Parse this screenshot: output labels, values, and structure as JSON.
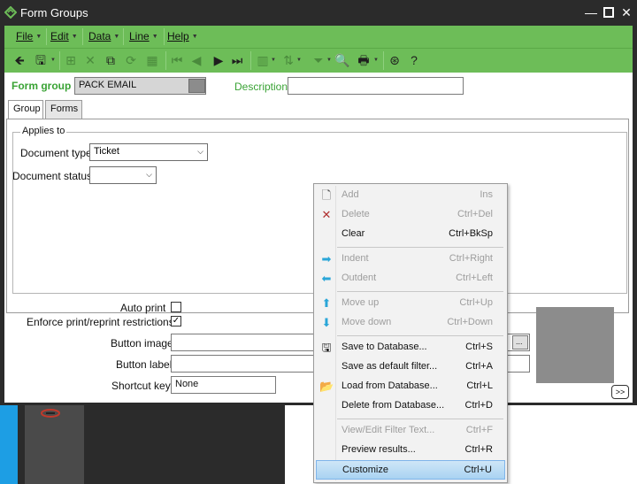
{
  "window": {
    "title": "Form Groups",
    "controls": {
      "minimize": "—",
      "close": "✕"
    }
  },
  "menubar": [
    "File",
    "Edit",
    "Data",
    "Line",
    "Help"
  ],
  "toolbar": {
    "icons": [
      "back-icon",
      "save-icon",
      "add-icon",
      "delete-icon",
      "copy-icon",
      "refresh-icon",
      "grid-icon",
      "first-record-icon",
      "prev-record-icon",
      "next-record-icon",
      "last-record-icon",
      "column-icon",
      "sort-icon",
      "filter-icon",
      "search-icon",
      "print-icon",
      "help-icon",
      "question-icon"
    ]
  },
  "header": {
    "form_group_label": "Form group",
    "form_group_value": "PACK EMAIL",
    "description_label": "Description",
    "description_value": ""
  },
  "tabs": [
    {
      "label": "Group",
      "active": true
    },
    {
      "label": "Forms",
      "active": false
    }
  ],
  "applies_to": {
    "title": "Applies to",
    "document_type_label": "Document type",
    "document_type_value": "Ticket",
    "document_status_label": "Document status",
    "document_status_value": ""
  },
  "options": {
    "auto_print_label": "Auto print",
    "auto_print_checked": false,
    "enforce_label": "Enforce print/reprint restrictions",
    "enforce_checked": true,
    "button_image_label": "Button image",
    "button_image_value": "",
    "button_label_label": "Button label",
    "button_label_value": "",
    "shortcut_key_label": "Shortcut key",
    "shortcut_key_value": "None",
    "browse_button": "...",
    "more_button": ">>"
  },
  "context_menu": [
    {
      "label": "Add",
      "shortcut": "Ins",
      "enabled": false,
      "icon": "new-document-icon",
      "glyph": "🗋",
      "color": "#555555"
    },
    {
      "label": "Delete",
      "shortcut": "Ctrl+Del",
      "enabled": false,
      "icon": "delete-x-icon",
      "glyph": "✕",
      "color": "#b03030"
    },
    {
      "label": "Clear",
      "shortcut": "Ctrl+BkSp",
      "enabled": true,
      "icon": "",
      "glyph": "",
      "color": "#555555"
    },
    {
      "sep": true
    },
    {
      "label": "Indent",
      "shortcut": "Ctrl+Right",
      "enabled": false,
      "icon": "indent-arrow-icon",
      "glyph": "➡",
      "color": "#2aa6d8"
    },
    {
      "label": "Outdent",
      "shortcut": "Ctrl+Left",
      "enabled": false,
      "icon": "outdent-arrow-icon",
      "glyph": "⬅",
      "color": "#2aa6d8"
    },
    {
      "sep": true
    },
    {
      "label": "Move up",
      "shortcut": "Ctrl+Up",
      "enabled": false,
      "icon": "move-up-icon",
      "glyph": "⬆",
      "color": "#2aa6d8"
    },
    {
      "label": "Move down",
      "shortcut": "Ctrl+Down",
      "enabled": false,
      "icon": "move-down-icon",
      "glyph": "⬇",
      "color": "#2aa6d8"
    },
    {
      "sep": true
    },
    {
      "label": "Save to Database...",
      "shortcut": "Ctrl+S",
      "enabled": true,
      "icon": "floppy-icon",
      "glyph": "🖫",
      "color": "#222222"
    },
    {
      "label": "Save as default filter...",
      "shortcut": "Ctrl+A",
      "enabled": true,
      "icon": "",
      "glyph": "",
      "color": "#555555"
    },
    {
      "label": "Load from Database...",
      "shortcut": "Ctrl+L",
      "enabled": true,
      "icon": "folder-open-icon",
      "glyph": "📂",
      "color": "#c8a030"
    },
    {
      "label": "Delete from Database...",
      "shortcut": "Ctrl+D",
      "enabled": true,
      "icon": "",
      "glyph": "",
      "color": "#555555"
    },
    {
      "sep": true
    },
    {
      "label": "View/Edit Filter Text...",
      "shortcut": "Ctrl+F",
      "enabled": false,
      "icon": "",
      "glyph": "",
      "color": "#555555"
    },
    {
      "label": "Preview results...",
      "shortcut": "Ctrl+R",
      "enabled": true,
      "icon": "",
      "glyph": "",
      "color": "#555555"
    },
    {
      "label": "Customize",
      "shortcut": "Ctrl+U",
      "enabled": true,
      "highlighted": true,
      "icon": "",
      "glyph": "",
      "color": "#555555"
    }
  ],
  "colors": {
    "accent_green": "#6dbd58",
    "label_green": "#3aa335",
    "titlebar": "#2b2b2b",
    "highlight": "#a9d3f2"
  }
}
